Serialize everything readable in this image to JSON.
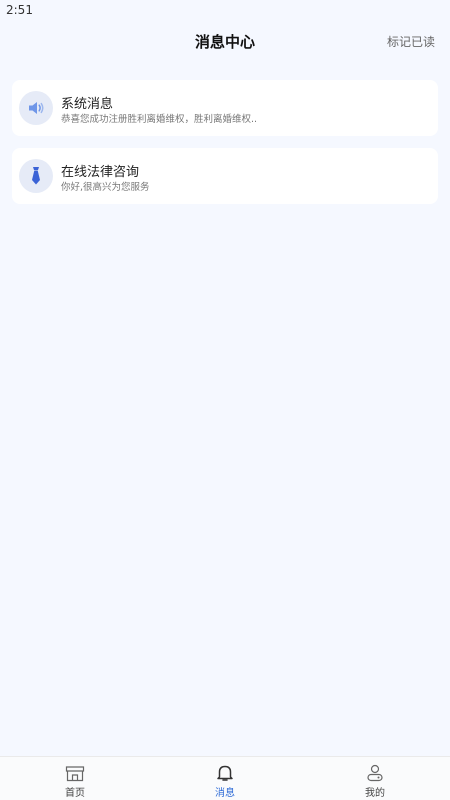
{
  "status_bar": {
    "time": "2:51"
  },
  "header": {
    "title": "消息中心",
    "mark_read": "标记已读"
  },
  "messages": [
    {
      "title": "系统消息",
      "preview": "恭喜您成功注册胜利离婚维权，胜利离婚维权..",
      "icon": "speaker-icon"
    },
    {
      "title": "在线法律咨询",
      "preview": "你好,很高兴为您服务",
      "icon": "tie-icon"
    }
  ],
  "tabbar": {
    "items": [
      {
        "label": "首页",
        "icon": "home-icon",
        "active": false
      },
      {
        "label": "消息",
        "icon": "bell-icon",
        "active": true
      },
      {
        "label": "我的",
        "icon": "user-icon",
        "active": false
      }
    ]
  },
  "colors": {
    "accent": "#2f6bd6",
    "background": "#f5f8ff",
    "card": "#ffffff"
  }
}
